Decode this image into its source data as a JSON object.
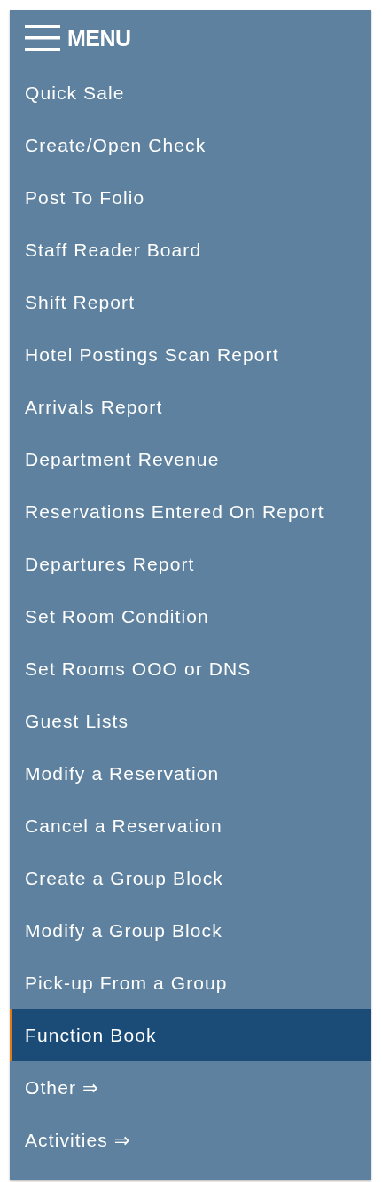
{
  "menu": {
    "title": "MENU",
    "items": [
      {
        "label": "Quick Sale",
        "selected": false
      },
      {
        "label": "Create/Open Check",
        "selected": false
      },
      {
        "label": "Post To Folio",
        "selected": false
      },
      {
        "label": "Staff Reader Board",
        "selected": false
      },
      {
        "label": "Shift Report",
        "selected": false
      },
      {
        "label": "Hotel Postings Scan Report",
        "selected": false
      },
      {
        "label": "Arrivals Report",
        "selected": false
      },
      {
        "label": "Department Revenue",
        "selected": false
      },
      {
        "label": "Reservations Entered On Report",
        "selected": false
      },
      {
        "label": "Departures Report",
        "selected": false
      },
      {
        "label": "Set Room Condition",
        "selected": false
      },
      {
        "label": "Set Rooms OOO or DNS",
        "selected": false
      },
      {
        "label": "Guest Lists",
        "selected": false
      },
      {
        "label": "Modify a Reservation",
        "selected": false
      },
      {
        "label": "Cancel a Reservation",
        "selected": false
      },
      {
        "label": "Create a Group Block",
        "selected": false
      },
      {
        "label": "Modify a Group Block",
        "selected": false
      },
      {
        "label": "Pick-up From a Group",
        "selected": false
      },
      {
        "label": "Function Book",
        "selected": true
      },
      {
        "label": "Other ⇒",
        "selected": false
      },
      {
        "label": "Activities ⇒",
        "selected": false
      }
    ]
  }
}
